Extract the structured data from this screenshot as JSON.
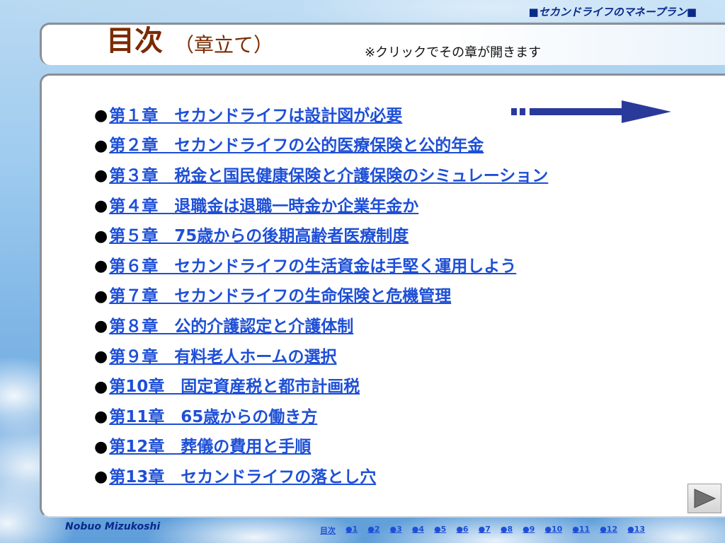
{
  "header": {
    "title": "■セカンドライフのマネープラン■"
  },
  "title": {
    "main": "目次",
    "sub": "（章立て）",
    "hint": "※クリックでその章が開きます"
  },
  "bullet": "●",
  "chapters": [
    "第１章　セカンドライフは設計図が必要",
    "第２章　セカンドライフの公的医療保険と公的年金",
    "第３章　税金と国民健康保険と介護保険のシミュレーション",
    "第４章　退職金は退職一時金か企業年金か",
    "第５章　75歳からの後期高齢者医療制度",
    "第６章　セカンドライフの生活資金は手堅く運用しよう",
    "第７章　セカンドライフの生命保険と危機管理",
    "第８章　公的介護認定と介護体制",
    "第９章　有料老人ホームの選択",
    "第10章　固定資産税と都市計画税",
    "第11章　65歳からの働き方",
    "第12章　葬儀の費用と手順",
    "第13章　セカンドライフの落とし穴"
  ],
  "footer": {
    "author": "Nobuo Mizukoshi",
    "nav": [
      "目次",
      "●1",
      "●2",
      "●3",
      "●4",
      "●5",
      "●6",
      "●7",
      "●8",
      "●9",
      "●10",
      "●11",
      "●12",
      "●13"
    ]
  },
  "colors": {
    "link": "#1e4fd6",
    "title": "#7a2a00",
    "arrow": "#2a3a9a"
  },
  "icons": {
    "arrow": "right-arrow-icon",
    "next": "next-play-icon"
  }
}
